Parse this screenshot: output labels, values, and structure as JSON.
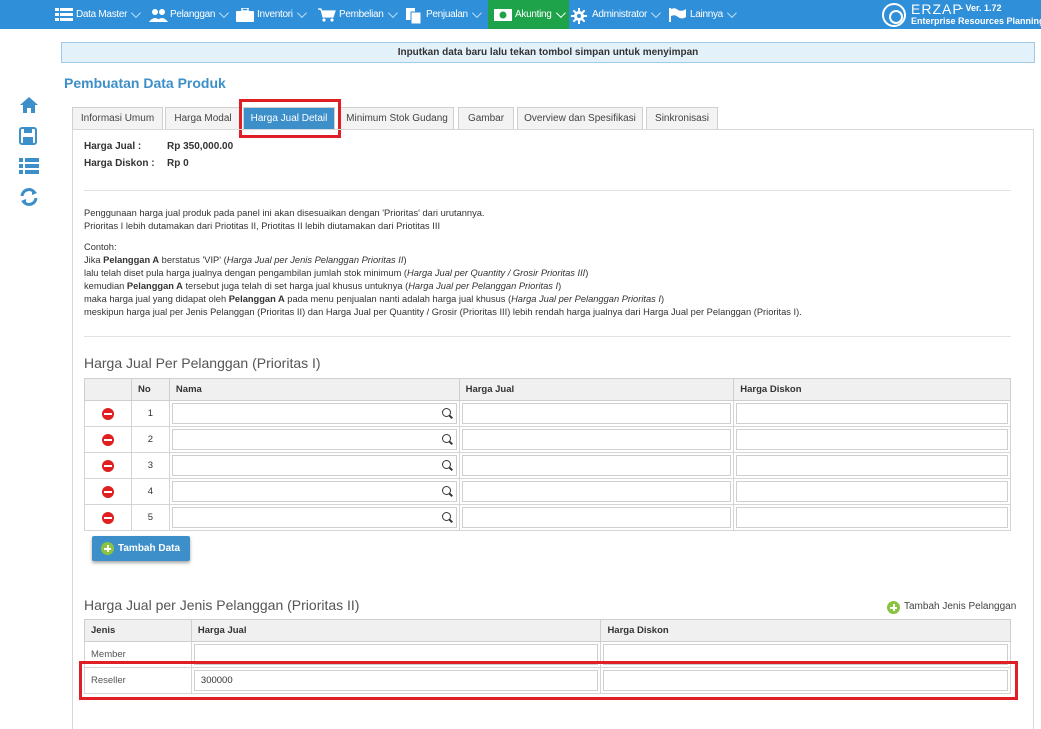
{
  "nav": {
    "items": [
      {
        "label": "Data Master",
        "icon": "list-icon"
      },
      {
        "label": "Pelanggan",
        "icon": "users-icon"
      },
      {
        "label": "Inventori",
        "icon": "briefcase-icon"
      },
      {
        "label": "Pembelian",
        "icon": "cart-icon"
      },
      {
        "label": "Penjualan",
        "icon": "document-icon"
      },
      {
        "label": "Akunting",
        "icon": "money-icon"
      },
      {
        "label": "Administrator",
        "icon": "gear-icon"
      },
      {
        "label": "Lainnya",
        "icon": "flag-icon"
      }
    ],
    "logo_text": "ERZAP",
    "version": "- Ver. 1.72",
    "tagline": "Enterprise Resources Planning"
  },
  "notice": "Inputkan data baru lalu tekan tombol simpan untuk menyimpan",
  "page_title": "Pembuatan Data Produk",
  "tabs": [
    "Informasi Umum",
    "Harga Modal",
    "Harga Jual Detail",
    "Minimum Stok Gudang",
    "Gambar",
    "Overview dan Spesifikasi",
    "Sinkronisasi"
  ],
  "active_tab": "Harga Jual Detail",
  "summary": {
    "harga_jual_label": "Harga Jual :",
    "harga_jual_value": "Rp 350,000.00",
    "harga_diskon_label": "Harga Diskon :",
    "harga_diskon_value": "Rp 0"
  },
  "desc": {
    "line1": "Penggunaan harga jual produk pada panel ini akan disesuaikan dengan 'Prioritas' dari urutannya.",
    "line2": "Prioritas I lebih dutamakan dari Priotitas II, Priotitas II lebih diutamakan dari Priotitas III",
    "contoh": "Contoh:",
    "ex1_a": "Jika ",
    "ex1_b": "Pelanggan A",
    "ex1_c": " berstatus 'VIP' (",
    "ex1_d": "Harga Jual per Jenis Pelanggan Prioritas II",
    "ex1_e": ")",
    "ex2_a": "lalu telah diset pula harga jualnya dengan pengambilan jumlah stok minimum (",
    "ex2_b": "Harga Jual per Quantity / Grosir Prioritas III",
    "ex2_c": ")",
    "ex3_a": "kemudian ",
    "ex3_b": "Pelanggan A",
    "ex3_c": " tersebut juga telah di set harga jual khusus untuknya (",
    "ex3_d": "Harga Jual per Pelanggan Prioritas I",
    "ex3_e": ")",
    "ex4_a": "maka harga jual yang didapat oleh ",
    "ex4_b": "Pelanggan A",
    "ex4_c": " pada menu penjualan nanti adalah harga jual khusus (",
    "ex4_d": "Harga Jual per Pelanggan Prioritas I",
    "ex4_e": ")",
    "ex5": "meskipun harga jual per Jenis Pelanggan (Prioritas II) dan Harga Jual per Quantity / Grosir (Prioritas III) lebih rendah harga jualnya dari Harga Jual per Pelanggan (Prioritas I)."
  },
  "section1": {
    "title": "Harga Jual Per Pelanggan (Prioritas I)",
    "headers": {
      "no": "No",
      "nama": "Nama",
      "harga_jual": "Harga Jual",
      "harga_diskon": "Harga Diskon"
    },
    "rows": [
      {
        "no": "1",
        "nama": "",
        "harga_jual": "",
        "harga_diskon": ""
      },
      {
        "no": "2",
        "nama": "",
        "harga_jual": "",
        "harga_diskon": ""
      },
      {
        "no": "3",
        "nama": "",
        "harga_jual": "",
        "harga_diskon": ""
      },
      {
        "no": "4",
        "nama": "",
        "harga_jual": "",
        "harga_diskon": ""
      },
      {
        "no": "5",
        "nama": "",
        "harga_jual": "",
        "harga_diskon": ""
      }
    ],
    "add_button": "Tambah Data"
  },
  "section2": {
    "title": "Harga Jual per Jenis Pelanggan (Prioritas II)",
    "add_link": "Tambah Jenis Pelanggan",
    "headers": {
      "jenis": "Jenis",
      "harga_jual": "Harga Jual",
      "harga_diskon": "Harga Diskon"
    },
    "rows": [
      {
        "jenis": "Member",
        "harga_jual": "",
        "harga_diskon": ""
      },
      {
        "jenis": "Reseller",
        "harga_jual": "300000",
        "harga_diskon": ""
      }
    ]
  }
}
